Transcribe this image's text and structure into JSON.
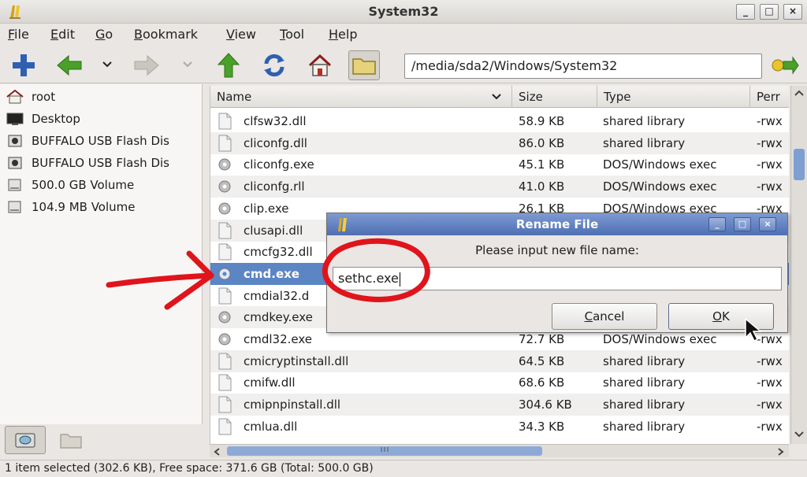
{
  "window": {
    "title": "System32",
    "minimize": "_",
    "maximize": "□",
    "close": "×"
  },
  "menu": [
    "File",
    "Edit",
    "Go",
    "Bookmark",
    "View",
    "Tool",
    "Help"
  ],
  "menu_mnemonics": [
    "F",
    "E",
    "G",
    "B",
    "V",
    "T",
    "H"
  ],
  "toolbar": {
    "address": "/media/sda2/Windows/System32"
  },
  "places": [
    {
      "label": "root",
      "icon": "home-icon"
    },
    {
      "label": "Desktop",
      "icon": "desktop-icon"
    },
    {
      "label": "BUFFALO USB Flash Dis",
      "icon": "usb-drive-icon"
    },
    {
      "label": "BUFFALO USB Flash Dis",
      "icon": "usb-drive-icon"
    },
    {
      "label": "500.0 GB Volume",
      "icon": "disk-volume-icon"
    },
    {
      "label": "104.9 MB Volume",
      "icon": "disk-volume-icon"
    }
  ],
  "columns": {
    "name": "Name",
    "size": "Size",
    "type": "Type",
    "perm": "Perr"
  },
  "files": [
    {
      "name": "clfsw32.dll",
      "size": "58.9 KB",
      "type": "shared library",
      "perm": "-rwx",
      "icon": "file-icon"
    },
    {
      "name": "cliconfg.dll",
      "size": "86.0 KB",
      "type": "shared library",
      "perm": "-rwx",
      "icon": "file-icon"
    },
    {
      "name": "cliconfg.exe",
      "size": "45.1 KB",
      "type": "DOS/Windows exec",
      "perm": "-rwx",
      "icon": "gear-icon"
    },
    {
      "name": "cliconfg.rll",
      "size": "41.0 KB",
      "type": "DOS/Windows exec",
      "perm": "-rwx",
      "icon": "gear-icon"
    },
    {
      "name": "clip.exe",
      "size": "26.1 KB",
      "type": "DOS/Windows exec",
      "perm": "-rwx",
      "icon": "gear-icon"
    },
    {
      "name": "clusapi.dll",
      "size": "",
      "type": "",
      "perm": "",
      "icon": "file-icon"
    },
    {
      "name": "cmcfg32.dll",
      "size": "",
      "type": "",
      "perm": "",
      "icon": "file-icon"
    },
    {
      "name": "cmd.exe",
      "size": "",
      "type": "",
      "perm": "",
      "icon": "gear-icon",
      "selected": true
    },
    {
      "name": "cmdial32.d",
      "size": "",
      "type": "",
      "perm": "",
      "icon": "file-icon"
    },
    {
      "name": "cmdkey.exe",
      "size": "",
      "type": "",
      "perm": "",
      "icon": "gear-icon"
    },
    {
      "name": "cmdl32.exe",
      "size": "72.7 KB",
      "type": "DOS/Windows exec",
      "perm": "-rwx",
      "icon": "gear-icon"
    },
    {
      "name": "cmicryptinstall.dll",
      "size": "64.5 KB",
      "type": "shared library",
      "perm": "-rwx",
      "icon": "file-icon"
    },
    {
      "name": "cmifw.dll",
      "size": "68.6 KB",
      "type": "shared library",
      "perm": "-rwx",
      "icon": "file-icon"
    },
    {
      "name": "cmipnpinstall.dll",
      "size": "304.6 KB",
      "type": "shared library",
      "perm": "-rwx",
      "icon": "file-icon"
    },
    {
      "name": "cmlua.dll",
      "size": "34.3 KB",
      "type": "shared library",
      "perm": "-rwx",
      "icon": "file-icon"
    }
  ],
  "status": "1 item selected (302.6 KB), Free space: 371.6 GB (Total: 500.0 GB)",
  "dialog": {
    "title": "Rename File",
    "prompt": "Please input new file name:",
    "value": "sethc.exe",
    "cancel": "Cancel",
    "ok": "OK",
    "minimize": "_",
    "maximize": "□",
    "close": "×"
  },
  "colors": {
    "selection": "#5c85c4",
    "dialog_title": "#4e6fb2",
    "annotation": "#e0141b"
  }
}
